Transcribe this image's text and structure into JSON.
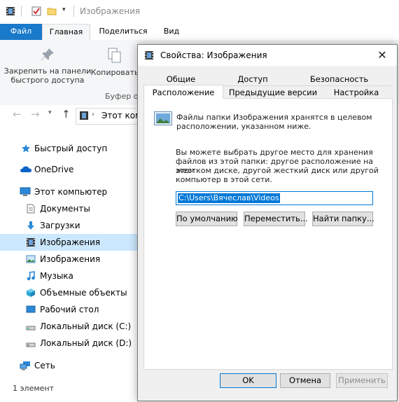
{
  "explorer": {
    "window_title": "Изображения",
    "ribbon_tabs": [
      "Файл",
      "Главная",
      "Поделиться",
      "Вид"
    ],
    "ribbon": {
      "pin_label_1": "Закрепить на панели",
      "pin_label_2": "быстрого доступа",
      "copy_label": "Копировать",
      "clipboard_group": "Буфер о"
    },
    "address_text": "Этот комп",
    "sidebar": [
      {
        "label": "Быстрый доступ",
        "icon": "star-icon"
      },
      {
        "label": "OneDrive",
        "icon": "cloud-icon"
      },
      {
        "label": "Этот компьютер",
        "icon": "computer-icon"
      },
      {
        "label": "Документы",
        "icon": "document-icon"
      },
      {
        "label": "Загрузки",
        "icon": "download-icon"
      },
      {
        "label": "Изображения",
        "icon": "film-icon",
        "selected": true
      },
      {
        "label": "Изображения",
        "icon": "picture-icon"
      },
      {
        "label": "Музыка",
        "icon": "music-icon"
      },
      {
        "label": "Объемные объекты",
        "icon": "cube-icon"
      },
      {
        "label": "Рабочий стол",
        "icon": "desktop-icon"
      },
      {
        "label": "Локальный диск (C:)",
        "icon": "drive-icon"
      },
      {
        "label": "Локальный диск (D:)",
        "icon": "drive-icon"
      },
      {
        "label": "Сеть",
        "icon": "network-icon"
      }
    ],
    "status": "1 элемент"
  },
  "dialog": {
    "title": "Свойства: Изображения",
    "tabs_row1": [
      "Общие",
      "Доступ",
      "Безопасность"
    ],
    "tabs_row2": [
      "Расположение",
      "Предыдущие версии",
      "Настройка"
    ],
    "info_line1": "Файлы папки Изображения хранятся в целевом",
    "info_line2": "расположении, указанном ниже.",
    "desc_lines": [
      "Вы можете выбрать другое место для хранения",
      "файлов из этой папки: другое расположение на этом",
      "жестком диске, другой жесткий диск или другой",
      "компьютер в этой сети."
    ],
    "path_value": "C:\\Users\\Вячеслав\\Videos",
    "buttons": {
      "default": "По умолчанию",
      "move": "Переместить...",
      "find": "Найти папку...",
      "ok": "OK",
      "cancel": "Отмена",
      "apply": "Применить"
    }
  },
  "colors": {
    "accent": "#0078d7",
    "file_tab": "#1979ca",
    "selected_row": "#cce8ff"
  }
}
